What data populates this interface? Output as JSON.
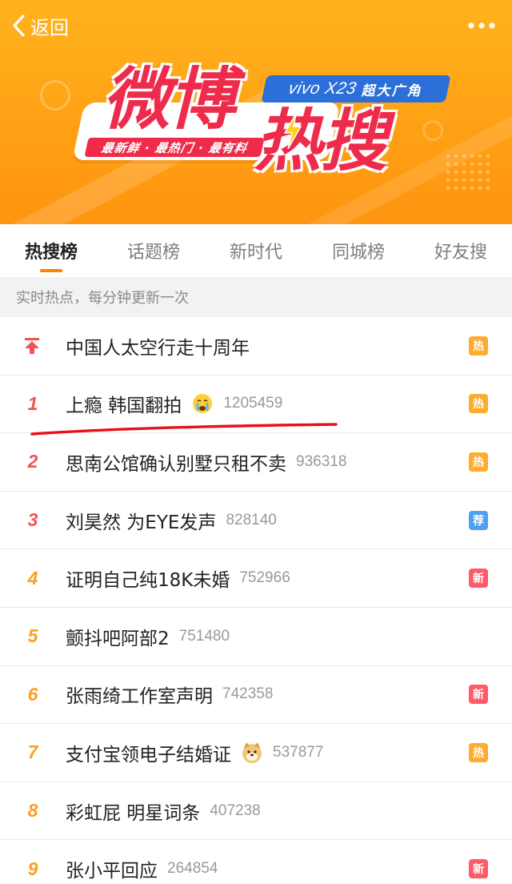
{
  "header": {
    "back_label": "返回",
    "more_icon": "more-dots-icon"
  },
  "banner": {
    "logo_part1": "微博",
    "logo_part2": "热搜",
    "sponsor_brand": "vivo X23",
    "sponsor_tag": "超大广角",
    "slogan": "最新鲜 · 最热门 · 最有料",
    "colors": {
      "background": "#ffa114",
      "logo": "#ee2b4a",
      "sponsor": "#2b6fd8"
    }
  },
  "tabs": [
    {
      "label": "热搜榜",
      "active": true
    },
    {
      "label": "话题榜",
      "active": false
    },
    {
      "label": "新时代",
      "active": false
    },
    {
      "label": "同城榜",
      "active": false
    },
    {
      "label": "好友搜",
      "active": false
    }
  ],
  "notice": "实时热点，每分钟更新一次",
  "list": [
    {
      "rank": "",
      "rank_icon": "pinned-arrow-up-icon",
      "title": "中国人太空行走十周年",
      "count": "",
      "emoji": "",
      "badge": "热",
      "badge_type": "hot"
    },
    {
      "rank": "1",
      "title": "上瘾 韩国翻拍",
      "count": "1205459",
      "emoji": "crying-face-emoji",
      "badge": "热",
      "badge_type": "hot"
    },
    {
      "rank": "2",
      "title": "思南公馆确认别墅只租不卖",
      "count": "936318",
      "emoji": "",
      "badge": "热",
      "badge_type": "hot"
    },
    {
      "rank": "3",
      "title": "刘昊然 为EYE发声",
      "count": "828140",
      "emoji": "",
      "badge": "荐",
      "badge_type": "rec"
    },
    {
      "rank": "4",
      "title": "证明自己纯18K未婚",
      "count": "752966",
      "emoji": "",
      "badge": "新",
      "badge_type": "new"
    },
    {
      "rank": "5",
      "title": "颤抖吧阿部2",
      "count": "751480",
      "emoji": "",
      "badge": "",
      "badge_type": ""
    },
    {
      "rank": "6",
      "title": "张雨绮工作室声明",
      "count": "742358",
      "emoji": "",
      "badge": "新",
      "badge_type": "new"
    },
    {
      "rank": "7",
      "title": "支付宝领电子结婚证",
      "count": "537877",
      "emoji": "doge-emoji",
      "badge": "热",
      "badge_type": "hot"
    },
    {
      "rank": "8",
      "title": "彩虹屁 明星词条",
      "count": "407238",
      "emoji": "",
      "badge": "",
      "badge_type": ""
    },
    {
      "rank": "9",
      "title": "张小平回应",
      "count": "264854",
      "emoji": "",
      "badge": "新",
      "badge_type": "new"
    }
  ],
  "colors": {
    "rank_top": "#f35252",
    "rank_normal": "#ff9e20",
    "badge_hot": "#ffab2d",
    "badge_rec": "#4ea1f2",
    "badge_new": "#ff5a6a",
    "tab_indicator": "#ff8200",
    "annotation_underline": "#e8101a"
  }
}
